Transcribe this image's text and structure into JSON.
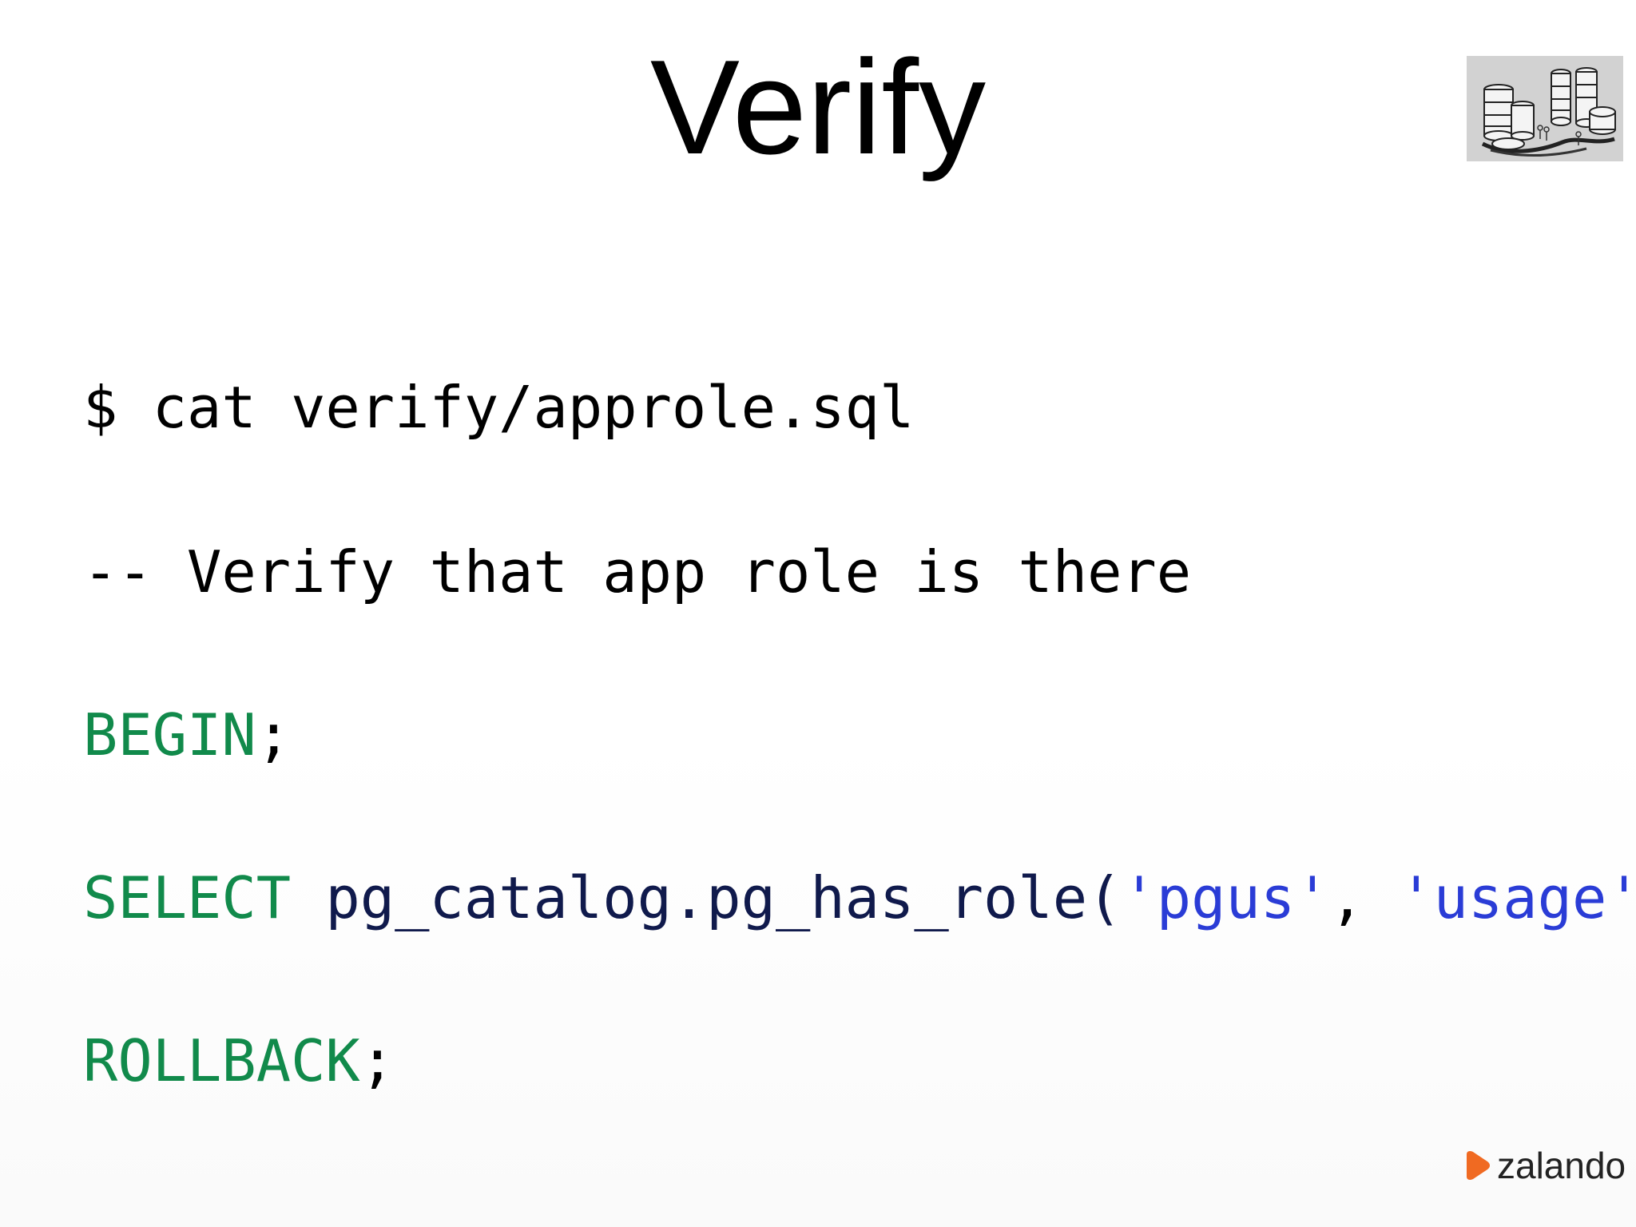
{
  "slide": {
    "title": "Verify"
  },
  "code": {
    "line1": "$ cat verify/approle.sql",
    "line2": "-- Verify that app role is there",
    "begin_kw": "BEGIN",
    "begin_semi": ";",
    "select_kw": "SELECT",
    "select_fn": "pg_catalog.pg_has_role(",
    "select_arg1": "'pgus'",
    "select_sep": ", ",
    "select_arg2": "'usage'",
    "select_end": ");",
    "rollback_kw": "ROLLBACK",
    "rollback_semi": ";"
  },
  "branding": {
    "logo_text": "zalando"
  },
  "colors": {
    "keyword": "#118a4b",
    "identifier": "#101a4c",
    "string": "#2a3cd6",
    "logo_orange": "#f06a22"
  },
  "icons": {
    "thumbnail": "database-illustration-icon",
    "logo": "zalando-logo-icon"
  }
}
